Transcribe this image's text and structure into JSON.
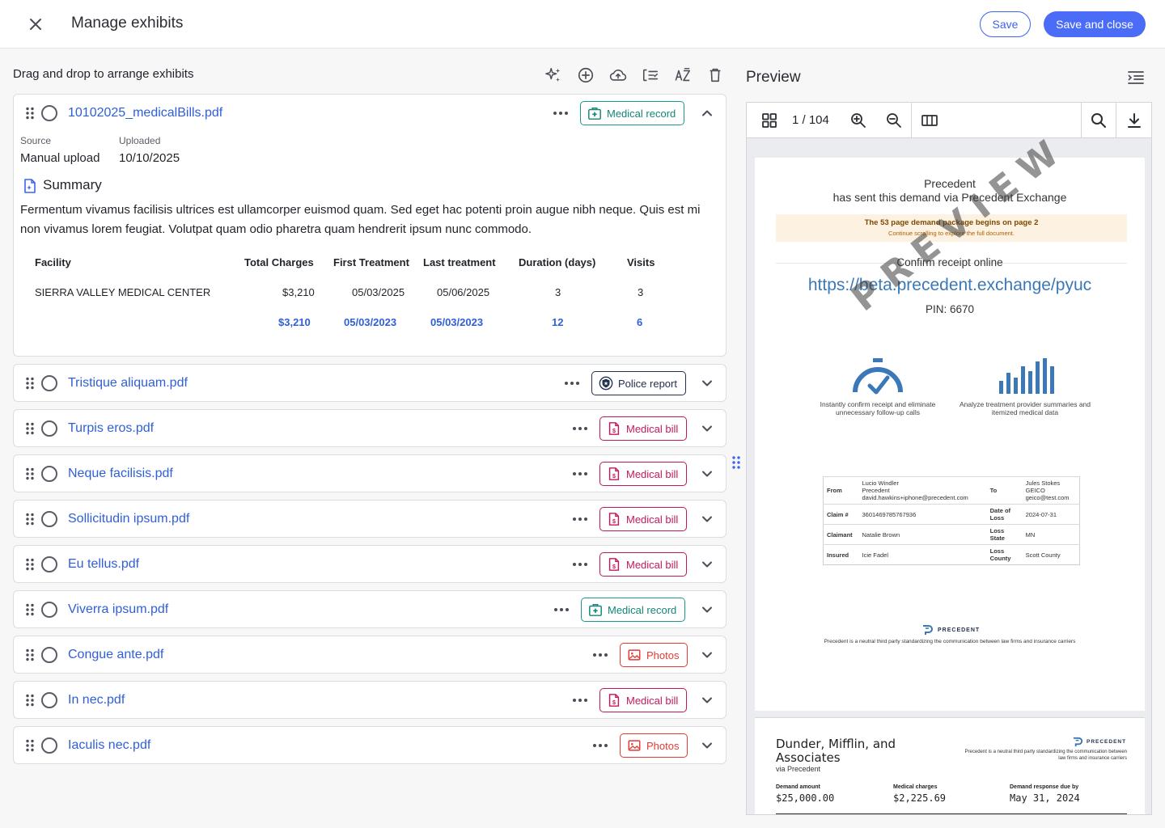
{
  "header": {
    "title": "Manage exhibits",
    "save_label": "Save",
    "save_close_label": "Save and close"
  },
  "left": {
    "heading": "Drag and drop to arrange exhibits"
  },
  "toolbar": {
    "icons": [
      "sparkle-icon",
      "add-circle-icon",
      "cloud-upload-icon",
      "checklist-icon",
      "sort-az-icon",
      "trash-icon"
    ]
  },
  "exhibits": [
    {
      "name": "10102025_medicalBills.pdf",
      "tag": "Medical record",
      "expanded": true,
      "source_label": "Source",
      "source_value": "Manual upload",
      "uploaded_label": "Uploaded",
      "uploaded_value": "10/10/2025",
      "summary_title": "Summary",
      "summary_text": "Fermentum vivamus facilisis ultrices est ullamcorper euismod quam. Sed eget hac potenti proin augue nibh neque. Quis est mi non vivamus lorem feugiat. Volutpat quam odio pharetra quam hendrerit ipsum nunc commodo.",
      "table": {
        "headers": [
          "Facility",
          "Total Charges",
          "First Treatment",
          "Last treatment",
          "Duration (days)",
          "Visits"
        ],
        "rows": [
          [
            "SIERRA VALLEY MEDICAL CENTER",
            "$3,210",
            "05/03/2025",
            "05/06/2025",
            "3",
            "3"
          ]
        ],
        "totals": [
          "",
          "$3,210",
          "05/03/2023",
          "05/03/2023",
          "12",
          "6"
        ]
      }
    },
    {
      "name": "Tristique aliquam.pdf",
      "tag": "Police report"
    },
    {
      "name": "Turpis eros.pdf",
      "tag": "Medical bill"
    },
    {
      "name": "Neque facilisis.pdf",
      "tag": "Medical bill"
    },
    {
      "name": "Sollicitudin ipsum.pdf",
      "tag": "Medical bill"
    },
    {
      "name": "Eu tellus.pdf",
      "tag": "Medical bill"
    },
    {
      "name": "Viverra ipsum.pdf",
      "tag": "Medical record"
    },
    {
      "name": "Congue ante.pdf",
      "tag": "Photos"
    },
    {
      "name": "In nec.pdf",
      "tag": "Medical bill"
    },
    {
      "name": "Iaculis nec.pdf",
      "tag": "Photos"
    }
  ],
  "preview": {
    "title": "Preview",
    "page_indicator": "1 / 104",
    "page1": {
      "sender": "Precedent",
      "sent_line": "has sent this demand via Precedent Exchange",
      "banner_title": "The 53 page demand package begins on page 2",
      "banner_sub": "Continue scrolling to explore the full document.",
      "confirm": "Confirm receipt online",
      "url": "https://beta.precedent.exchange/pyuc",
      "pin": "PIN: 6670",
      "watermark": "PREVIEW",
      "feature1": "Instantly confirm receipt and eliminate unnecessary follow-up calls",
      "feature2": "Analyze treatment provider summaries and itemized medical data",
      "table": [
        [
          "From",
          "Lucio Windler\nPrecedent\ndavid.hawkins+iphone@precedent.com",
          "To",
          "Jules Stokes\nGEICO\ngeico@test.com"
        ],
        [
          "Claim #",
          "3601469785767936",
          "Date of Loss",
          "2024-07-31"
        ],
        [
          "Claimant",
          "Natalie Brown",
          "Loss State",
          "MN"
        ],
        [
          "Insured",
          "Icie Fadel",
          "Loss County",
          "Scott County"
        ]
      ],
      "logo_text": "PRECEDENT",
      "footer": "Precedent is a neutral third party standardizing the communication between law firms and insurance carriers"
    },
    "page2": {
      "firm": "Dunder, Mifflin, and Associates",
      "via": "via Precedent",
      "logo_text": "PRECEDENT",
      "tagline": "Precedent is a neutral third party standardizing the communication between law firms and insurance carriers",
      "fields": [
        {
          "label": "Demand amount",
          "value": "$25,000.00"
        },
        {
          "label": "Medical charges",
          "value": "$2,225.69"
        },
        {
          "label": "Demand response due by",
          "value": "May 31, 2024"
        }
      ]
    }
  },
  "colors": {
    "accent": "#4a6cf7",
    "link": "#2f5fd8",
    "medical_record": "#1a9a8a",
    "medical_bill": "#c2185b",
    "police_report": "#22304d",
    "photos": "#e53935"
  }
}
